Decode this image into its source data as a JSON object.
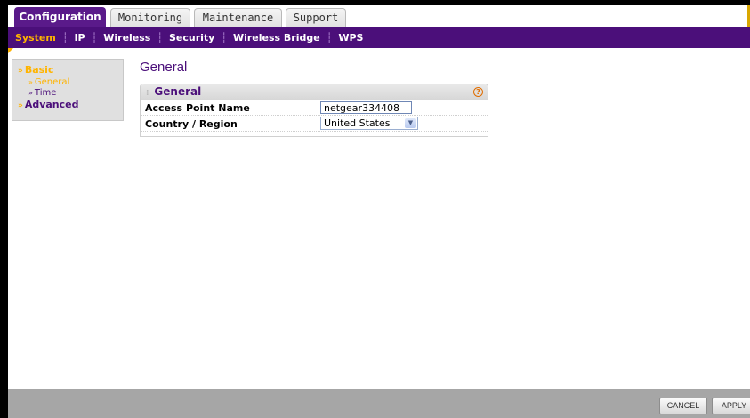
{
  "tabs": [
    {
      "label": "Configuration",
      "active": true
    },
    {
      "label": "Monitoring",
      "active": false
    },
    {
      "label": "Maintenance",
      "active": false
    },
    {
      "label": "Support",
      "active": false
    }
  ],
  "submenu": [
    {
      "label": "System",
      "active": true
    },
    {
      "label": "IP",
      "active": false
    },
    {
      "label": "Wireless",
      "active": false
    },
    {
      "label": "Security",
      "active": false
    },
    {
      "label": "Wireless Bridge",
      "active": false
    },
    {
      "label": "WPS",
      "active": false
    }
  ],
  "leftnav": {
    "basic": {
      "label": "Basic",
      "mark": "»"
    },
    "general": {
      "label": "General",
      "mark": "»"
    },
    "time": {
      "label": "Time",
      "mark": "»"
    },
    "advanced": {
      "label": "Advanced",
      "mark": "»"
    }
  },
  "page": {
    "title": "General"
  },
  "panel": {
    "title": "General",
    "help_icon": "?",
    "fields": {
      "ap_name": {
        "label": "Access Point Name",
        "value": "netgear334408"
      },
      "country": {
        "label": "Country / Region",
        "value": "United States"
      }
    }
  },
  "buttons": {
    "cancel": "CANCEL",
    "apply": "APPLY"
  },
  "colors": {
    "brand_purple": "#4b0f7a",
    "accent_orange": "#ffb400"
  }
}
